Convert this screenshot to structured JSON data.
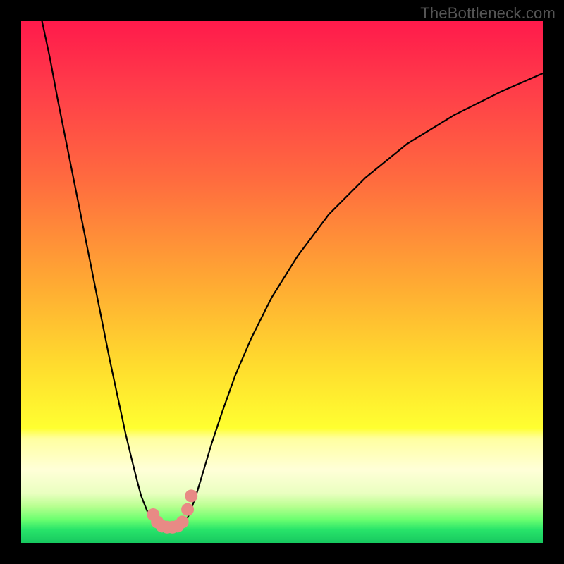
{
  "watermark": "TheBottleneck.com",
  "chart_data": {
    "type": "line",
    "title": "",
    "xlabel": "",
    "ylabel": "",
    "xlim": [
      0,
      100
    ],
    "ylim": [
      0,
      100
    ],
    "gradient_stops": [
      {
        "offset": 0,
        "color": "#ff1a4b"
      },
      {
        "offset": 0.12,
        "color": "#ff3a4a"
      },
      {
        "offset": 0.3,
        "color": "#ff6a3f"
      },
      {
        "offset": 0.5,
        "color": "#ffa933"
      },
      {
        "offset": 0.65,
        "color": "#ffd92e"
      },
      {
        "offset": 0.78,
        "color": "#ffff30"
      },
      {
        "offset": 0.8,
        "color": "#ffffa0"
      },
      {
        "offset": 0.86,
        "color": "#ffffd8"
      },
      {
        "offset": 0.905,
        "color": "#eaffc0"
      },
      {
        "offset": 0.93,
        "color": "#b8ff90"
      },
      {
        "offset": 0.955,
        "color": "#6cff70"
      },
      {
        "offset": 0.975,
        "color": "#28e46a"
      },
      {
        "offset": 1.0,
        "color": "#17c85f"
      }
    ],
    "series": [
      {
        "name": "left-curve",
        "color": "#000000",
        "x": [
          4,
          5.5,
          7,
          9,
          11,
          13,
          15,
          17,
          18.5,
          20,
          21.2,
          22.2,
          23,
          23.8,
          24.4,
          25,
          25.6
        ],
        "y": [
          100,
          93,
          85,
          75,
          65,
          55,
          45,
          35,
          28,
          21,
          16,
          12,
          9,
          7,
          5.5,
          4.5,
          4
        ]
      },
      {
        "name": "right-curve",
        "color": "#000000",
        "x": [
          31.4,
          32,
          32.8,
          33.8,
          35,
          36.5,
          38.5,
          41,
          44,
          48,
          53,
          59,
          66,
          74,
          83,
          92,
          100
        ],
        "y": [
          4,
          5,
          7,
          10,
          14,
          19,
          25,
          32,
          39,
          47,
          55,
          63,
          70,
          76.5,
          82,
          86.5,
          90
        ]
      }
    ],
    "valley_connector": {
      "color": "#000000",
      "x": [
        25.6,
        26.5,
        27.5,
        28.5,
        29.5,
        30.5,
        31.4
      ],
      "y": [
        4,
        3.4,
        3.1,
        3.0,
        3.1,
        3.4,
        4
      ]
    },
    "markers": {
      "color": "#e88a85",
      "radius_px": 9,
      "points": [
        {
          "x": 25.3,
          "y": 5.4
        },
        {
          "x": 26.1,
          "y": 4.0
        },
        {
          "x": 27.0,
          "y": 3.2
        },
        {
          "x": 28.0,
          "y": 3.0
        },
        {
          "x": 29.0,
          "y": 3.0
        },
        {
          "x": 30.0,
          "y": 3.2
        },
        {
          "x": 30.9,
          "y": 4.0
        },
        {
          "x": 31.9,
          "y": 6.4
        },
        {
          "x": 32.6,
          "y": 9.0
        }
      ]
    }
  }
}
